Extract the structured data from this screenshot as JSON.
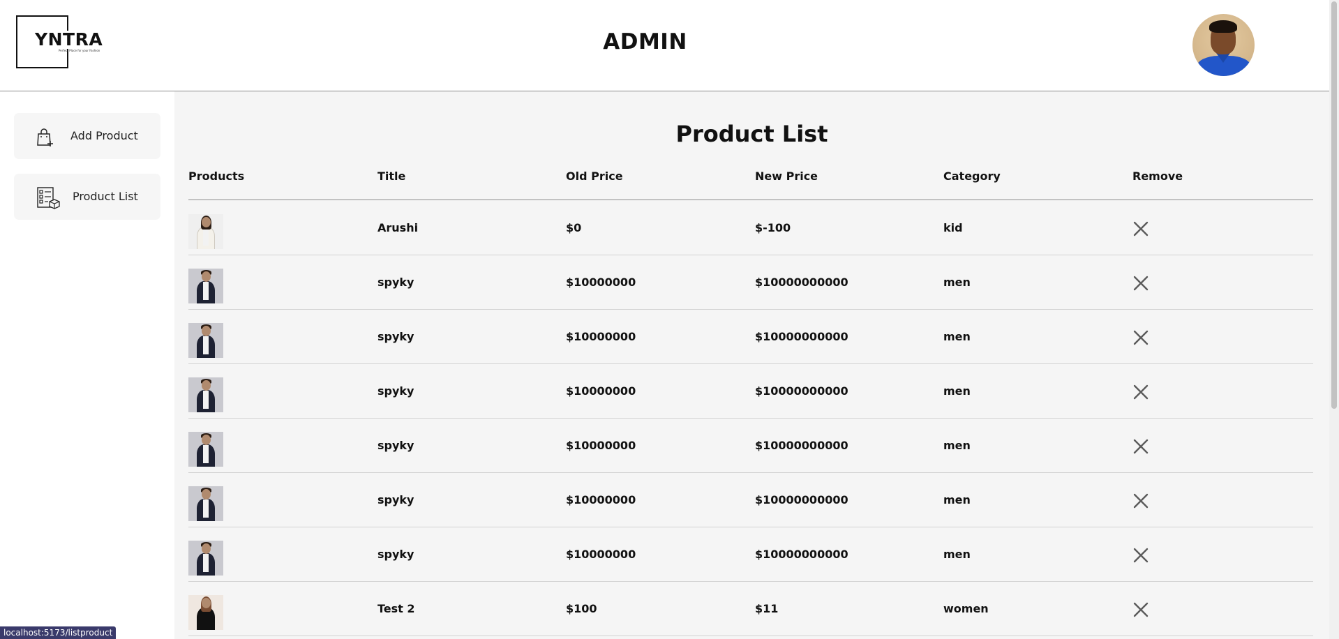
{
  "header": {
    "logo_text": "YNTRA",
    "logo_tagline": "Perfect Place for your Fashion",
    "title": "ADMIN"
  },
  "sidebar": {
    "items": [
      {
        "label": "Add Product",
        "icon": "shopping-bag-add-icon"
      },
      {
        "label": "Product List",
        "icon": "product-list-icon"
      }
    ]
  },
  "main": {
    "title": "Product List",
    "columns": [
      "Products",
      "Title",
      "Old Price",
      "New Price",
      "Category",
      "Remove"
    ],
    "rows": [
      {
        "image": "girl",
        "title": "Arushi",
        "old_price": "$0",
        "new_price": "$-100",
        "category": "kid"
      },
      {
        "image": "man",
        "title": "spyky",
        "old_price": "$10000000",
        "new_price": "$10000000000",
        "category": "men"
      },
      {
        "image": "man",
        "title": "spyky",
        "old_price": "$10000000",
        "new_price": "$10000000000",
        "category": "men"
      },
      {
        "image": "man",
        "title": "spyky",
        "old_price": "$10000000",
        "new_price": "$10000000000",
        "category": "men"
      },
      {
        "image": "man",
        "title": "spyky",
        "old_price": "$10000000",
        "new_price": "$10000000000",
        "category": "men"
      },
      {
        "image": "man",
        "title": "spyky",
        "old_price": "$10000000",
        "new_price": "$10000000000",
        "category": "men"
      },
      {
        "image": "man",
        "title": "spyky",
        "old_price": "$10000000",
        "new_price": "$10000000000",
        "category": "men"
      },
      {
        "image": "girl2",
        "title": "Test 2",
        "old_price": "$100",
        "new_price": "$11",
        "category": "women"
      }
    ]
  },
  "status_bar": {
    "url": "localhost:5173/listproduct"
  },
  "colors": {
    "main_bg": "#f5f5f5",
    "sidebar_button_bg": "#f6f6f6",
    "remove_icon": "#5a5a5a",
    "status_bar_bg": "#3a3a6b"
  }
}
